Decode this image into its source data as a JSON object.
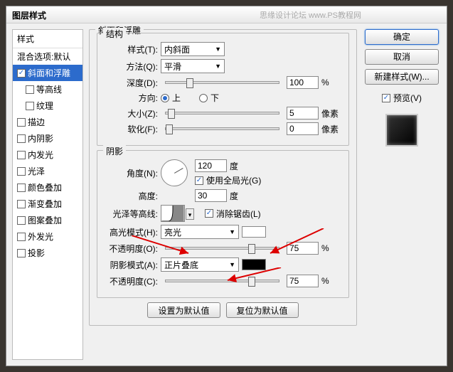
{
  "window": {
    "title": "图层样式"
  },
  "styles": {
    "header": "样式",
    "blend_opts": "混合选项:默认",
    "bevel": {
      "label": "斜面和浮雕",
      "checked": true,
      "selected": true
    },
    "contour": {
      "label": "等高线",
      "checked": false
    },
    "texture": {
      "label": "纹理",
      "checked": false
    },
    "stroke": {
      "label": "描边",
      "checked": false
    },
    "inner_shadow": {
      "label": "内阴影",
      "checked": false
    },
    "inner_glow": {
      "label": "内发光",
      "checked": false
    },
    "satin": {
      "label": "光泽",
      "checked": false
    },
    "color_overlay": {
      "label": "颜色叠加",
      "checked": false
    },
    "gradient_overlay": {
      "label": "渐变叠加",
      "checked": false
    },
    "pattern_overlay": {
      "label": "图案叠加",
      "checked": false
    },
    "outer_glow": {
      "label": "外发光",
      "checked": false
    },
    "drop_shadow": {
      "label": "投影",
      "checked": false
    }
  },
  "bevel_panel": {
    "title": "斜面和浮雕",
    "structure": {
      "legend": "结构",
      "style_label": "样式(T):",
      "style_value": "内斜面",
      "technique_label": "方法(Q):",
      "technique_value": "平滑",
      "depth_label": "深度(D):",
      "depth_value": "100",
      "depth_unit": "%",
      "direction_label": "方向:",
      "up": "上",
      "down": "下",
      "size_label": "大小(Z):",
      "size_value": "5",
      "size_unit": "像素",
      "soften_label": "软化(F):",
      "soften_value": "0",
      "soften_unit": "像素"
    },
    "shading": {
      "legend": "阴影",
      "angle_label": "角度(N):",
      "angle_value": "120",
      "angle_unit": "度",
      "global_light": "使用全局光(G)",
      "altitude_label": "高度:",
      "altitude_value": "30",
      "altitude_unit": "度",
      "gloss_contour_label": "光泽等高线:",
      "antialias": "消除锯齿(L)",
      "highlight_mode_label": "高光模式(H):",
      "highlight_mode_value": "亮光",
      "highlight_opacity_label": "不透明度(O):",
      "highlight_opacity_value": "75",
      "opacity_unit": "%",
      "shadow_mode_label": "阴影模式(A):",
      "shadow_mode_value": "正片叠底",
      "shadow_opacity_label": "不透明度(C):",
      "shadow_opacity_value": "75"
    },
    "defaults": {
      "set": "设置为默认值",
      "reset": "复位为默认值"
    }
  },
  "right": {
    "ok": "确定",
    "cancel": "取消",
    "new_style": "新建样式(W)...",
    "preview_label": "预览(V)"
  },
  "watermark": "思缘设计论坛  www.PS教程网"
}
